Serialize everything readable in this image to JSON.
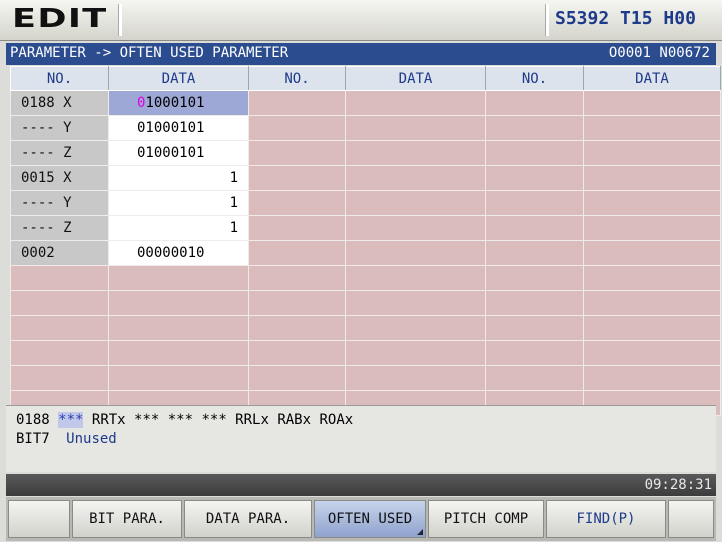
{
  "title": {
    "mode": "EDIT",
    "status_s": "S5392",
    "status_t": "T15",
    "status_h": "H00"
  },
  "header": {
    "path": "PARAMETER -> OFTEN USED PARAMETER",
    "program": "O0001 N00672"
  },
  "columns": [
    "NO.",
    "DATA",
    "NO.",
    "DATA",
    "NO.",
    "DATA"
  ],
  "rows": [
    {
      "no": "0188 X",
      "data_first": "0",
      "data_rest": "1000101"
    },
    {
      "no": "---- Y",
      "data": "01000101"
    },
    {
      "no": "---- Z",
      "data": "01000101"
    },
    {
      "no": "0015 X",
      "data": "1"
    },
    {
      "no": "---- Y",
      "data": "1"
    },
    {
      "no": "---- Z",
      "data": "1"
    },
    {
      "no": "0002",
      "data": "00000010"
    }
  ],
  "info": {
    "param_no": "0188",
    "bits_highlight": "***",
    "bits_rest": "RRTx *** *** *** RRLx RABx ROAx",
    "bit_label": "BIT7",
    "bit_desc": "Unused"
  },
  "clock": "09:28:31",
  "softkeys": [
    "",
    "BIT PARA.",
    "DATA PARA.",
    "OFTEN USED",
    "PITCH COMP",
    "FIND(P)",
    ""
  ],
  "active_softkey": "OFTEN USED",
  "colors": {
    "header_bar": "#2b4c8e",
    "empty_cell": "#dbbcbc",
    "selected_cell": "#9ea8d6",
    "accent": "#1e3a8a"
  }
}
